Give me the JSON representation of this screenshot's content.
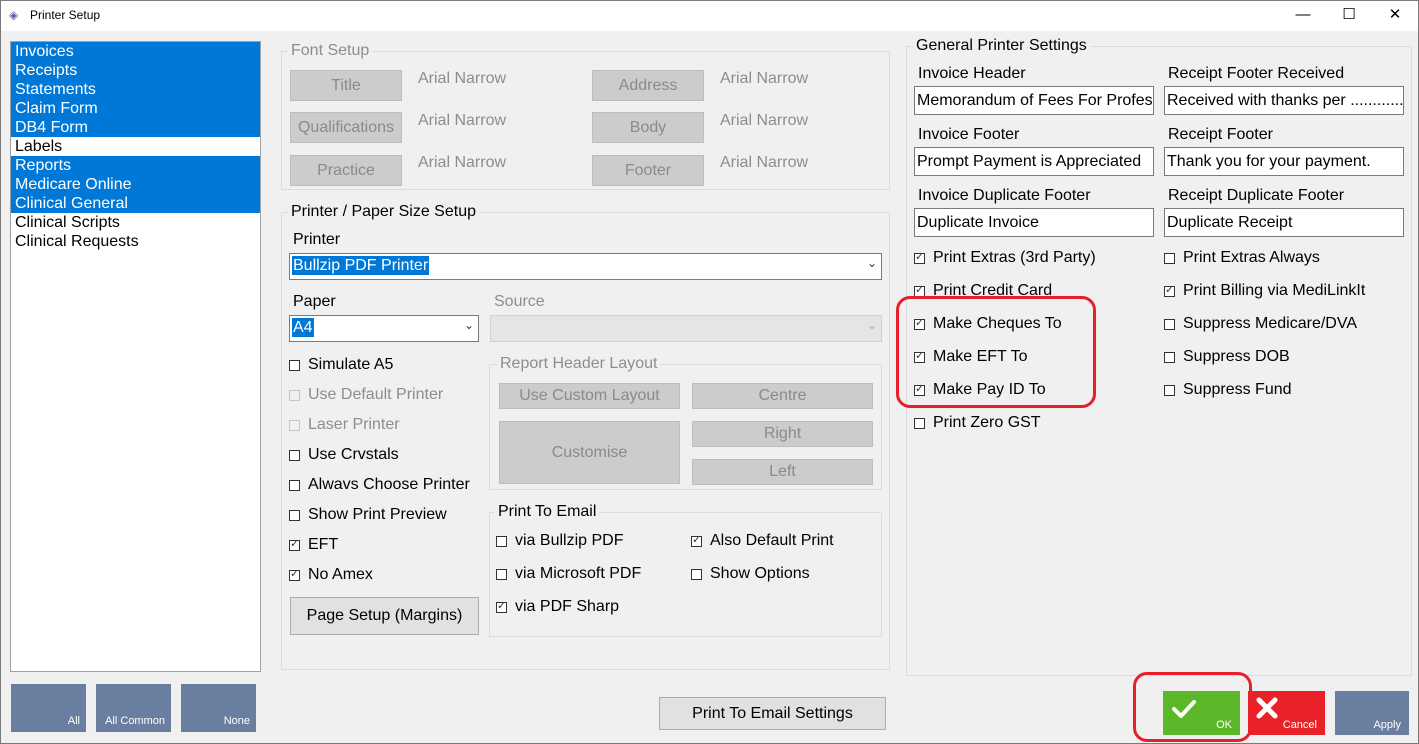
{
  "window": {
    "title": "Printer Setup",
    "minimize": "—",
    "maximize": "☐",
    "close": "✕"
  },
  "sidebar": {
    "items": [
      {
        "label": "Invoices",
        "selected": true
      },
      {
        "label": "Receipts",
        "selected": true
      },
      {
        "label": "Statements",
        "selected": true
      },
      {
        "label": "Claim Form",
        "selected": true
      },
      {
        "label": "DB4 Form",
        "selected": true
      },
      {
        "label": "Labels",
        "selected": false
      },
      {
        "label": "Reports",
        "selected": true
      },
      {
        "label": "Medicare Online",
        "selected": true
      },
      {
        "label": "Clinical General",
        "selected": true
      },
      {
        "label": "Clinical Scripts",
        "selected": false
      },
      {
        "label": "Clinical Requests",
        "selected": false
      }
    ],
    "btn_all": "All",
    "btn_all_common": "All Common",
    "btn_none": "None"
  },
  "font_setup": {
    "legend": "Font Setup",
    "title_btn": "Title",
    "title_font": "Arial Narrow",
    "qual_btn": "Qualifications",
    "qual_font": "Arial Narrow",
    "practice_btn": "Practice",
    "practice_font": "Arial Narrow",
    "address_btn": "Address",
    "address_font": "Arial Narrow",
    "body_btn": "Body",
    "body_font": "Arial Narrow",
    "footer_btn": "Footer",
    "footer_font": "Arial Narrow"
  },
  "paper_setup": {
    "legend": "Printer / Paper Size Setup",
    "printer_label": "Printer",
    "printer_value": "Bullzip PDF Printer",
    "paper_label": "Paper",
    "paper_value": "A4",
    "source_label": "Source",
    "simulate_a5": "Simulate A5",
    "use_default_printer": "Use Default Printer",
    "laser_printer": "Laser Printer",
    "use_crystals": "Use Crvstals",
    "always_choose": "Alwavs Choose Printer",
    "show_preview": "Show Print Preview",
    "eft": "EFT",
    "no_amex": "No Amex",
    "page_setup_btn": "Page Setup (Margins)"
  },
  "report_header": {
    "legend": "Report Header Layout",
    "use_custom": "Use Custom Layout",
    "customise": "Customise",
    "centre": "Centre",
    "right": "Right",
    "left": "Left"
  },
  "print_email": {
    "legend": "Print To Email",
    "via_bullzip": "via Bullzip PDF",
    "via_microsoft": "via Microsoft PDF",
    "via_sharp": "via PDF Sharp",
    "also_default": "Also Default Print",
    "show_options": "Show Options",
    "settings_btn": "Print To Email Settings"
  },
  "general": {
    "legend": "General Printer Settings",
    "invoice_header_label": "Invoice Header",
    "invoice_header_value": "Memorandum of Fees For Professional Services",
    "receipt_footer_received_label": "Receipt Footer Received",
    "receipt_footer_received_value": "Received with thanks per ..................",
    "invoice_footer_label": "Invoice Footer",
    "invoice_footer_value": "Prompt Payment is Appreciated",
    "receipt_footer_label": "Receipt Footer",
    "receipt_footer_value": "Thank you for your payment.",
    "invoice_dup_label": "Invoice Duplicate Footer",
    "invoice_dup_value": "Duplicate Invoice",
    "receipt_dup_label": "Receipt Duplicate Footer",
    "receipt_dup_value": "Duplicate Receipt",
    "print_extras": "Print Extras (3rd Party)",
    "print_credit_card": "Print Credit Card",
    "make_cheques": "Make Cheques To",
    "make_eft": "Make EFT To",
    "make_payid": "Make Pay ID To",
    "print_zero_gst": "Print Zero GST",
    "print_extras_always": "Print Extras Always",
    "print_billing": "Print Billing via MediLinkIt",
    "suppress_medicare": "Suppress Medicare/DVA",
    "suppress_dob": "Suppress DOB",
    "suppress_fund": "Suppress Fund"
  },
  "footer": {
    "ok": "OK",
    "cancel": "Cancel",
    "apply": "Apply"
  },
  "colors": {
    "selection": "#0078d7",
    "ok": "#5bb829",
    "cancel": "#e82228",
    "apply": "#6a7ea0",
    "highlight": "#e5202a"
  }
}
